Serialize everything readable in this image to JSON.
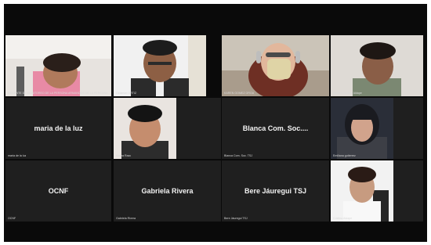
{
  "participants": {
    "p1": {
      "name": "DOCENTE DE MONITOREO DE LA PERSONA ARMANDOS DE LA PERSONA ...",
      "type": "video"
    },
    "p2": {
      "name": "Cinamon ORTIZ",
      "type": "video"
    },
    "p3": {
      "name": "KAREN GOMEZ OROA",
      "type": "video"
    },
    "p4": {
      "name": "Sandra Cristina Aldape",
      "type": "video"
    },
    "p5": {
      "name": "maria de la luz",
      "caption": "maria de la luz",
      "type": "name"
    },
    "p6": {
      "name": "Mayra Razo",
      "type": "video"
    },
    "p7": {
      "name": "Blanca Com. Soc....",
      "caption": "Blanca Com. Soc. TSJ",
      "type": "name"
    },
    "p8": {
      "name": "Emiliana gutierrez",
      "type": "video"
    },
    "p9": {
      "name": "OCNF",
      "caption": "OCNF",
      "type": "name"
    },
    "p10": {
      "name": "Gabriela Rivera",
      "caption": "Gabriela Rivera",
      "type": "name"
    },
    "p11": {
      "name": "Bere Jáuregui TSJ",
      "caption": "Bere Jáuregui TSJ",
      "type": "name"
    },
    "p12": {
      "name": "Cristina Aldape",
      "type": "video"
    }
  },
  "colors": {
    "background": "#0a0a0a",
    "tile": "#1f1f1f",
    "text": "#f2f2f2"
  }
}
